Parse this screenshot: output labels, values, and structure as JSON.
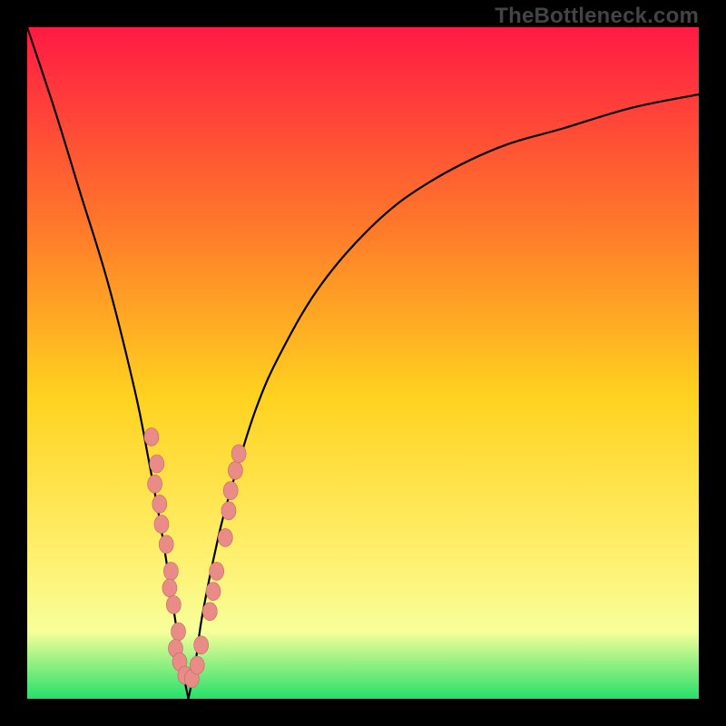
{
  "watermark": {
    "text": "TheBottleneck.com"
  },
  "colors": {
    "frame_bg": "#000000",
    "gradient_top": "#ff1a44",
    "gradient_mid1": "#ff7a2a",
    "gradient_mid2": "#ffd21f",
    "gradient_mid3": "#ffef6b",
    "gradient_mid4": "#f7ff9a",
    "gradient_bottom": "#25e06a",
    "curve": "#000000",
    "marker_fill": "#e98b86",
    "marker_stroke": "#c46762"
  },
  "chart_data": {
    "type": "line",
    "title": "",
    "xlabel": "",
    "ylabel": "",
    "xlim": [
      0,
      100
    ],
    "ylim": [
      0,
      100
    ],
    "grid": false,
    "legend": false,
    "notch_x": 24,
    "series": [
      {
        "name": "bottleneck-curve",
        "x": [
          0,
          4,
          8,
          12,
          16,
          18,
          20,
          22,
          23,
          24,
          25,
          26,
          28,
          30,
          34,
          38,
          44,
          52,
          60,
          70,
          80,
          90,
          100
        ],
        "y": [
          100,
          88,
          75,
          62,
          46,
          36,
          25,
          12,
          5,
          0,
          5,
          12,
          22,
          30,
          43,
          52,
          62,
          71,
          77,
          82,
          85,
          88,
          90
        ]
      }
    ],
    "annotations": [
      {
        "name": "left-dot-cluster",
        "points": [
          [
            18.5,
            39
          ],
          [
            19.3,
            35
          ],
          [
            19.0,
            32
          ],
          [
            19.7,
            29
          ],
          [
            20.0,
            26
          ],
          [
            20.7,
            23
          ],
          [
            21.4,
            19
          ],
          [
            21.2,
            16.5
          ],
          [
            21.8,
            14
          ],
          [
            22.5,
            10
          ],
          [
            22.1,
            7.5
          ],
          [
            22.7,
            5.5
          ],
          [
            23.5,
            3.5
          ]
        ]
      },
      {
        "name": "right-dot-cluster",
        "points": [
          [
            24.5,
            3
          ],
          [
            25.3,
            5
          ],
          [
            25.9,
            8
          ],
          [
            27.2,
            13
          ],
          [
            27.7,
            16
          ],
          [
            28.2,
            19
          ],
          [
            29.5,
            24
          ],
          [
            30.0,
            28
          ],
          [
            30.3,
            31
          ],
          [
            31.0,
            34
          ],
          [
            31.5,
            36.5
          ]
        ]
      }
    ]
  }
}
